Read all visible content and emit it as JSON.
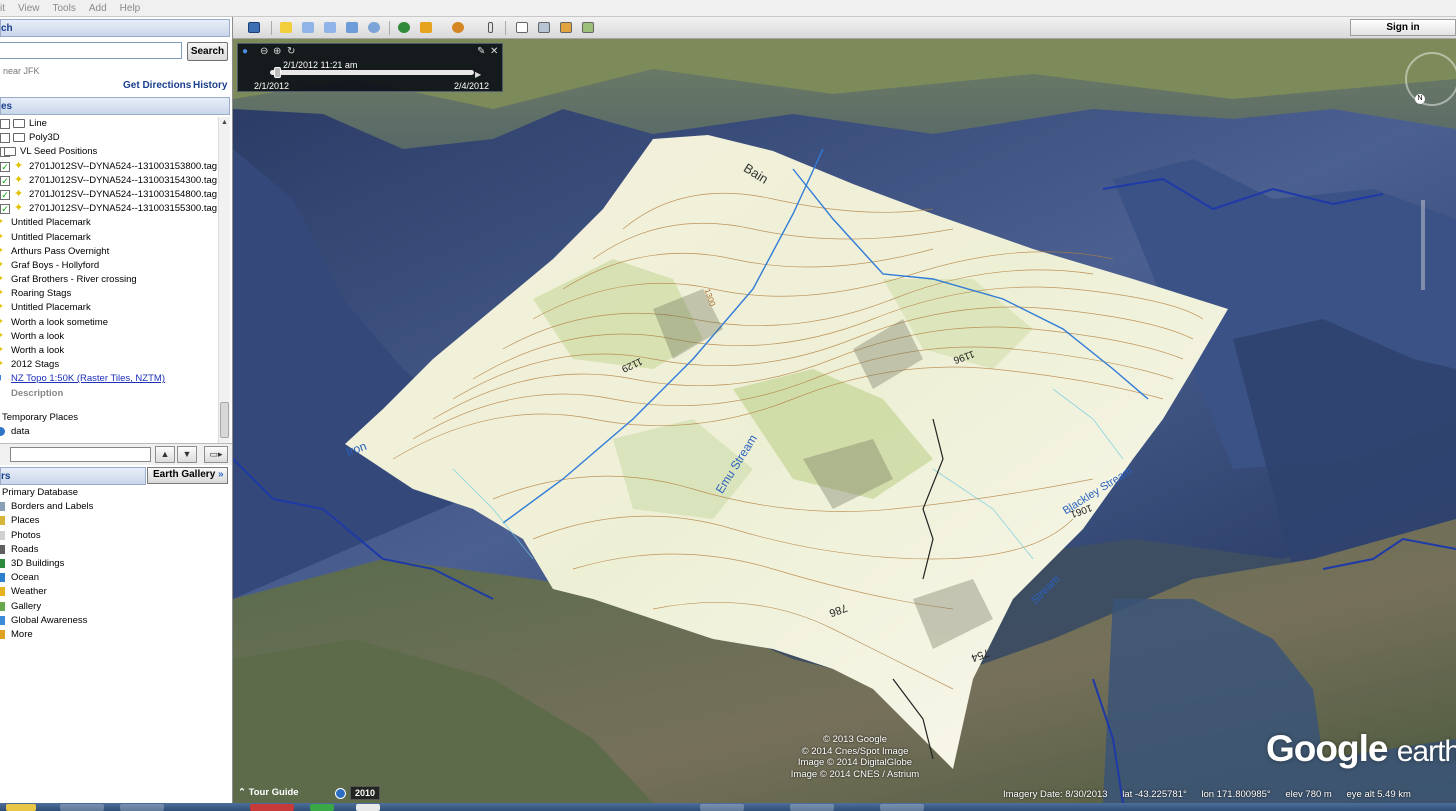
{
  "menu": [
    "it",
    "View",
    "Tools",
    "Add",
    "Help"
  ],
  "search": {
    "header": "ch",
    "button": "Search",
    "hint": "near JFK",
    "get_directions": "Get Directions",
    "history": "History"
  },
  "places": {
    "header": "es",
    "items": [
      {
        "label": "Line",
        "indent": 29,
        "type": "folder",
        "checked": false
      },
      {
        "label": "Poly3D",
        "indent": 29,
        "type": "folder",
        "checked": false
      },
      {
        "label": "VL Seed Positions",
        "indent": 20,
        "type": "folder",
        "checked": false
      },
      {
        "label": "2701J012SV--DYNA524--131003153800.tag",
        "indent": 29,
        "type": "pin",
        "checked": true
      },
      {
        "label": "2701J012SV--DYNA524--131003154300.tag",
        "indent": 29,
        "type": "pin",
        "checked": true
      },
      {
        "label": "2701J012SV--DYNA524--131003154800.tag",
        "indent": 29,
        "type": "pin",
        "checked": true
      },
      {
        "label": "2701J012SV--DYNA524--131003155300.tag",
        "indent": 29,
        "type": "pin",
        "checked": true
      },
      {
        "label": "Untitled Placemark",
        "indent": 11,
        "type": "pin-edge"
      },
      {
        "label": "Untitled Placemark",
        "indent": 11,
        "type": "pin-edge"
      },
      {
        "label": "Arthurs Pass Overnight",
        "indent": 11,
        "type": "pin-edge"
      },
      {
        "label": "Graf Boys - Hollyford",
        "indent": 11,
        "type": "pin-edge"
      },
      {
        "label": "Graf Brothers - River crossing",
        "indent": 11,
        "type": "pin-edge"
      },
      {
        "label": "Roaring Stags",
        "indent": 11,
        "type": "pin-edge"
      },
      {
        "label": "Untitled Placemark",
        "indent": 11,
        "type": "pin-edge"
      },
      {
        "label": "Worth a look sometime",
        "indent": 11,
        "type": "pin-edge"
      },
      {
        "label": "Worth a look",
        "indent": 11,
        "type": "pin-edge"
      },
      {
        "label": "Worth a look",
        "indent": 11,
        "type": "pin-edge"
      },
      {
        "label": "2012 Stags",
        "indent": 11,
        "type": "pin-edge"
      },
      {
        "label": "NZ Topo 1:50K (Raster Tiles, NZTM)",
        "indent": 11,
        "type": "link"
      },
      {
        "label": "Description",
        "indent": 11,
        "type": "desc"
      }
    ],
    "temporary": "Temporary Places",
    "data": "data"
  },
  "layers": {
    "header": "rs",
    "earth_gallery": "Earth Gallery",
    "earth_gallery_chevron": "»",
    "items": [
      {
        "label": "Primary Database",
        "icon": "none"
      },
      {
        "label": "Borders and Labels",
        "icon": "#8aa0b8"
      },
      {
        "label": "Places",
        "icon": "#d7b43a"
      },
      {
        "label": "Photos",
        "icon": "#d0d0d0"
      },
      {
        "label": "Roads",
        "icon": "#5f5f5f"
      },
      {
        "label": "3D Buildings",
        "icon": "#2c8a3c"
      },
      {
        "label": "Ocean",
        "icon": "#2e7fd0"
      },
      {
        "label": "Weather",
        "icon": "#e7b21c"
      },
      {
        "label": "Gallery",
        "icon": "#6aa84f"
      },
      {
        "label": "Global Awareness",
        "icon": "#3b8bd6"
      },
      {
        "label": "More",
        "icon": "#e0a020"
      }
    ]
  },
  "toolbar": {
    "sign_in": "Sign in"
  },
  "time_slider": {
    "current": "2/1/2012  11:21 am",
    "start": "2/1/2012",
    "end": "2/4/2012",
    "position": 0.02
  },
  "map_labels": [
    "Bain",
    "Emu Stream",
    "Blackley Stream",
    "Stream",
    "1129",
    "1196",
    "1061",
    "786",
    "754",
    "1300",
    "Iron"
  ],
  "credits": [
    "© 2013 Google",
    "© 2014 Cnes/Spot Image",
    "Image © 2014 DigitalGlobe",
    "Image © 2014 CNES / Astrium"
  ],
  "bottom": {
    "tour_guide": "Tour Guide",
    "year": "2010",
    "logo_google": "Google",
    "logo_earth": "earth"
  },
  "status": {
    "imagery_date": "Imagery Date: 8/30/2013",
    "lat": "lat  -43.225781°",
    "lon": "lon  171.800985°",
    "elev": "elev   780 m",
    "eye_alt": "eye alt   5.49 km"
  },
  "colors": {
    "link": "#1b2fb8",
    "header_text": "#1a3f8c",
    "topo_paper": "#f4f1e3",
    "contour": "#a36a2e",
    "water": "#2f7bd8"
  }
}
